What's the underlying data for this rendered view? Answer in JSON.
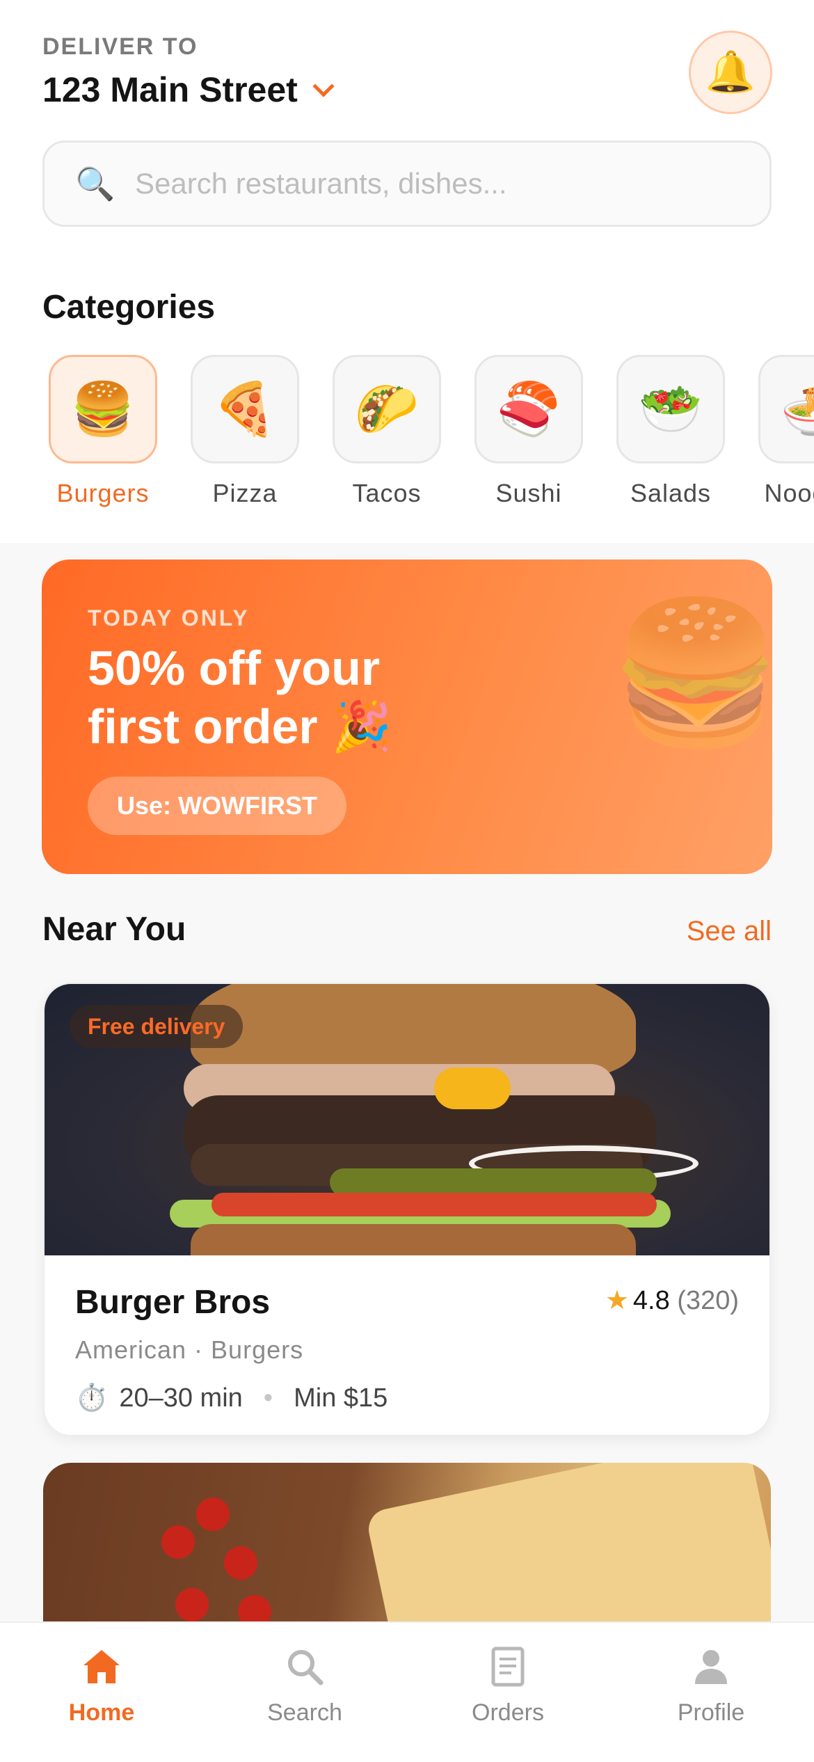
{
  "header": {
    "deliver_label": "DELIVER TO",
    "address": "123 Main Street",
    "notifications_icon": "bell-icon"
  },
  "search": {
    "placeholder": "Search restaurants, dishes...",
    "value": "",
    "icon": "search-icon"
  },
  "categories": {
    "title": "Categories",
    "selected": "Burgers",
    "items": [
      {
        "label": "Burgers",
        "emoji": "🍔"
      },
      {
        "label": "Pizza",
        "emoji": "🍕"
      },
      {
        "label": "Tacos",
        "emoji": "🌮"
      },
      {
        "label": "Sushi",
        "emoji": "🍣"
      },
      {
        "label": "Salads",
        "emoji": "🥗"
      },
      {
        "label": "Noodles",
        "emoji": "🍜"
      }
    ]
  },
  "promo": {
    "kicker": "TODAY ONLY",
    "title": "50% off your first order 🎉",
    "code_button": "Use: WOWFIRST",
    "art_emoji": "🍔"
  },
  "near_you": {
    "title": "Near You",
    "see_all": "See all",
    "restaurants": [
      {
        "badge": "Free delivery",
        "name": "Burger Bros",
        "rating": "4.8",
        "reviews": "(320)",
        "cuisine": "American · Burgers",
        "delivery_time": "20–30 min",
        "minimum": "Min $15"
      }
    ]
  },
  "tabbar": {
    "active": "Home",
    "items": [
      {
        "label": "Home",
        "icon": "home-icon"
      },
      {
        "label": "Search",
        "icon": "search-icon"
      },
      {
        "label": "Orders",
        "icon": "receipt-icon"
      },
      {
        "label": "Profile",
        "icon": "person-icon"
      }
    ]
  },
  "colors": {
    "accent": "#f26a21",
    "promo_start": "#ff6a26",
    "promo_end": "#ffa066",
    "star": "#f5a623"
  }
}
